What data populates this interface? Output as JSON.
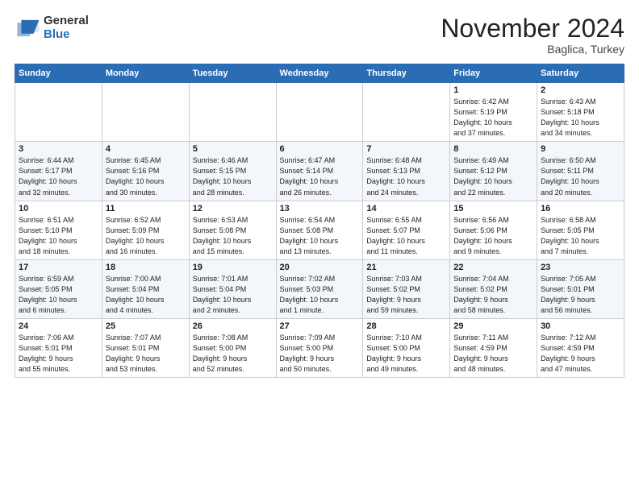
{
  "logo": {
    "general": "General",
    "blue": "Blue"
  },
  "title": "November 2024",
  "location": "Baglica, Turkey",
  "weekdays": [
    "Sunday",
    "Monday",
    "Tuesday",
    "Wednesday",
    "Thursday",
    "Friday",
    "Saturday"
  ],
  "rows": [
    [
      {
        "day": "",
        "info": ""
      },
      {
        "day": "",
        "info": ""
      },
      {
        "day": "",
        "info": ""
      },
      {
        "day": "",
        "info": ""
      },
      {
        "day": "",
        "info": ""
      },
      {
        "day": "1",
        "info": "Sunrise: 6:42 AM\nSunset: 5:19 PM\nDaylight: 10 hours\nand 37 minutes."
      },
      {
        "day": "2",
        "info": "Sunrise: 6:43 AM\nSunset: 5:18 PM\nDaylight: 10 hours\nand 34 minutes."
      }
    ],
    [
      {
        "day": "3",
        "info": "Sunrise: 6:44 AM\nSunset: 5:17 PM\nDaylight: 10 hours\nand 32 minutes."
      },
      {
        "day": "4",
        "info": "Sunrise: 6:45 AM\nSunset: 5:16 PM\nDaylight: 10 hours\nand 30 minutes."
      },
      {
        "day": "5",
        "info": "Sunrise: 6:46 AM\nSunset: 5:15 PM\nDaylight: 10 hours\nand 28 minutes."
      },
      {
        "day": "6",
        "info": "Sunrise: 6:47 AM\nSunset: 5:14 PM\nDaylight: 10 hours\nand 26 minutes."
      },
      {
        "day": "7",
        "info": "Sunrise: 6:48 AM\nSunset: 5:13 PM\nDaylight: 10 hours\nand 24 minutes."
      },
      {
        "day": "8",
        "info": "Sunrise: 6:49 AM\nSunset: 5:12 PM\nDaylight: 10 hours\nand 22 minutes."
      },
      {
        "day": "9",
        "info": "Sunrise: 6:50 AM\nSunset: 5:11 PM\nDaylight: 10 hours\nand 20 minutes."
      }
    ],
    [
      {
        "day": "10",
        "info": "Sunrise: 6:51 AM\nSunset: 5:10 PM\nDaylight: 10 hours\nand 18 minutes."
      },
      {
        "day": "11",
        "info": "Sunrise: 6:52 AM\nSunset: 5:09 PM\nDaylight: 10 hours\nand 16 minutes."
      },
      {
        "day": "12",
        "info": "Sunrise: 6:53 AM\nSunset: 5:08 PM\nDaylight: 10 hours\nand 15 minutes."
      },
      {
        "day": "13",
        "info": "Sunrise: 6:54 AM\nSunset: 5:08 PM\nDaylight: 10 hours\nand 13 minutes."
      },
      {
        "day": "14",
        "info": "Sunrise: 6:55 AM\nSunset: 5:07 PM\nDaylight: 10 hours\nand 11 minutes."
      },
      {
        "day": "15",
        "info": "Sunrise: 6:56 AM\nSunset: 5:06 PM\nDaylight: 10 hours\nand 9 minutes."
      },
      {
        "day": "16",
        "info": "Sunrise: 6:58 AM\nSunset: 5:05 PM\nDaylight: 10 hours\nand 7 minutes."
      }
    ],
    [
      {
        "day": "17",
        "info": "Sunrise: 6:59 AM\nSunset: 5:05 PM\nDaylight: 10 hours\nand 6 minutes."
      },
      {
        "day": "18",
        "info": "Sunrise: 7:00 AM\nSunset: 5:04 PM\nDaylight: 10 hours\nand 4 minutes."
      },
      {
        "day": "19",
        "info": "Sunrise: 7:01 AM\nSunset: 5:04 PM\nDaylight: 10 hours\nand 2 minutes."
      },
      {
        "day": "20",
        "info": "Sunrise: 7:02 AM\nSunset: 5:03 PM\nDaylight: 10 hours\nand 1 minute."
      },
      {
        "day": "21",
        "info": "Sunrise: 7:03 AM\nSunset: 5:02 PM\nDaylight: 9 hours\nand 59 minutes."
      },
      {
        "day": "22",
        "info": "Sunrise: 7:04 AM\nSunset: 5:02 PM\nDaylight: 9 hours\nand 58 minutes."
      },
      {
        "day": "23",
        "info": "Sunrise: 7:05 AM\nSunset: 5:01 PM\nDaylight: 9 hours\nand 56 minutes."
      }
    ],
    [
      {
        "day": "24",
        "info": "Sunrise: 7:06 AM\nSunset: 5:01 PM\nDaylight: 9 hours\nand 55 minutes."
      },
      {
        "day": "25",
        "info": "Sunrise: 7:07 AM\nSunset: 5:01 PM\nDaylight: 9 hours\nand 53 minutes."
      },
      {
        "day": "26",
        "info": "Sunrise: 7:08 AM\nSunset: 5:00 PM\nDaylight: 9 hours\nand 52 minutes."
      },
      {
        "day": "27",
        "info": "Sunrise: 7:09 AM\nSunset: 5:00 PM\nDaylight: 9 hours\nand 50 minutes."
      },
      {
        "day": "28",
        "info": "Sunrise: 7:10 AM\nSunset: 5:00 PM\nDaylight: 9 hours\nand 49 minutes."
      },
      {
        "day": "29",
        "info": "Sunrise: 7:11 AM\nSunset: 4:59 PM\nDaylight: 9 hours\nand 48 minutes."
      },
      {
        "day": "30",
        "info": "Sunrise: 7:12 AM\nSunset: 4:59 PM\nDaylight: 9 hours\nand 47 minutes."
      }
    ]
  ]
}
